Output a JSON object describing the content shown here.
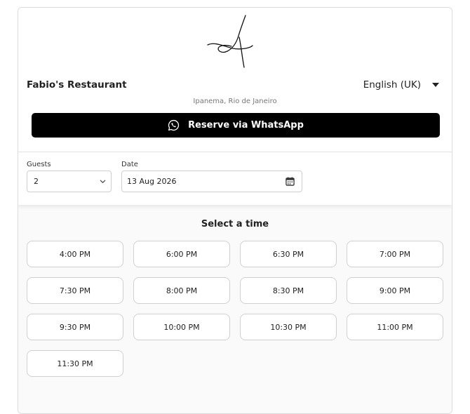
{
  "restaurant": {
    "name": "Fabio's Restaurant",
    "location": "Ipanema, Rio de Janeiro"
  },
  "language": {
    "selected": "English (UK)"
  },
  "whatsapp": {
    "label": "Reserve via WhatsApp",
    "icon": "whatsapp-icon"
  },
  "form": {
    "guests_label": "Guests",
    "guests_value": "2",
    "date_label": "Date",
    "date_value": "13 Aug 2026"
  },
  "times": {
    "title": "Select a time",
    "slots": [
      "4:00 PM",
      "6:00 PM",
      "6:30 PM",
      "7:00 PM",
      "7:30 PM",
      "8:00 PM",
      "8:30 PM",
      "9:00 PM",
      "9:30 PM",
      "10:00 PM",
      "10:30 PM",
      "11:00 PM",
      "11:30 PM"
    ]
  },
  "colors": {
    "button_bg": "#000000",
    "button_text": "#ffffff",
    "section_bg": "#fafafa"
  }
}
